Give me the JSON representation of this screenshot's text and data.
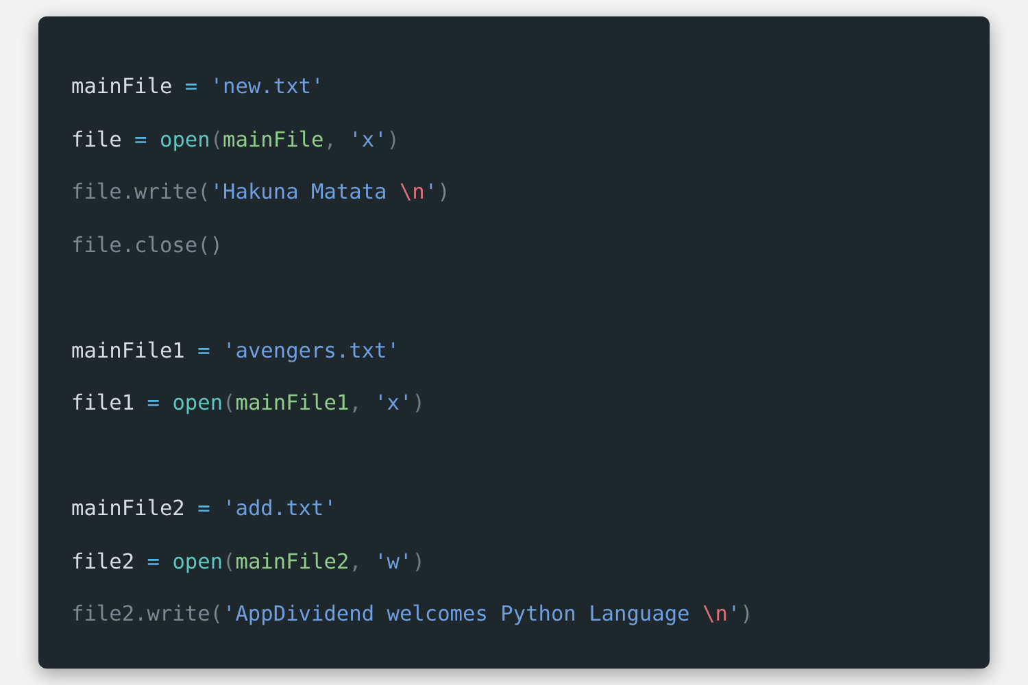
{
  "code_groups": [
    [
      {
        "tokens": [
          {
            "text": "mainFile",
            "kind": "name"
          },
          {
            "text": " = ",
            "kind": "op"
          },
          {
            "text": "'new.txt'",
            "kind": "string"
          }
        ]
      },
      {
        "tokens": [
          {
            "text": "file",
            "kind": "name"
          },
          {
            "text": " = ",
            "kind": "op"
          },
          {
            "text": "open",
            "kind": "func"
          },
          {
            "text": "(",
            "kind": "punct"
          },
          {
            "text": "mainFile",
            "kind": "arg"
          },
          {
            "text": ", ",
            "kind": "punct"
          },
          {
            "text": "'x'",
            "kind": "string"
          },
          {
            "text": ")",
            "kind": "punct"
          }
        ]
      },
      {
        "tokens": [
          {
            "text": "file.write(",
            "kind": "dim"
          },
          {
            "text": "'Hakuna Matata ",
            "kind": "string"
          },
          {
            "text": "\\n",
            "kind": "escape"
          },
          {
            "text": "'",
            "kind": "string"
          },
          {
            "text": ")",
            "kind": "dim"
          }
        ]
      },
      {
        "tokens": [
          {
            "text": "file.close()",
            "kind": "dim"
          }
        ]
      }
    ],
    [
      {
        "tokens": [
          {
            "text": "mainFile1",
            "kind": "name"
          },
          {
            "text": " = ",
            "kind": "op"
          },
          {
            "text": "'avengers.txt'",
            "kind": "string"
          }
        ]
      },
      {
        "tokens": [
          {
            "text": "file1",
            "kind": "name"
          },
          {
            "text": " = ",
            "kind": "op"
          },
          {
            "text": "open",
            "kind": "func"
          },
          {
            "text": "(",
            "kind": "punct"
          },
          {
            "text": "mainFile1",
            "kind": "arg"
          },
          {
            "text": ", ",
            "kind": "punct"
          },
          {
            "text": "'x'",
            "kind": "string"
          },
          {
            "text": ")",
            "kind": "punct"
          }
        ]
      }
    ],
    [
      {
        "tokens": [
          {
            "text": "mainFile2",
            "kind": "name"
          },
          {
            "text": " = ",
            "kind": "op"
          },
          {
            "text": "'add.txt'",
            "kind": "string"
          }
        ]
      },
      {
        "tokens": [
          {
            "text": "file2",
            "kind": "name"
          },
          {
            "text": " = ",
            "kind": "op"
          },
          {
            "text": "open",
            "kind": "func"
          },
          {
            "text": "(",
            "kind": "punct"
          },
          {
            "text": "mainFile2",
            "kind": "arg"
          },
          {
            "text": ", ",
            "kind": "punct"
          },
          {
            "text": "'w'",
            "kind": "string"
          },
          {
            "text": ")",
            "kind": "punct"
          }
        ]
      },
      {
        "tokens": [
          {
            "text": "file2.write(",
            "kind": "dim"
          },
          {
            "text": "'AppDividend welcomes Python Language ",
            "kind": "string"
          },
          {
            "text": "\\n",
            "kind": "escape"
          },
          {
            "text": "'",
            "kind": "string"
          },
          {
            "text": ")",
            "kind": "dim"
          }
        ]
      }
    ]
  ]
}
